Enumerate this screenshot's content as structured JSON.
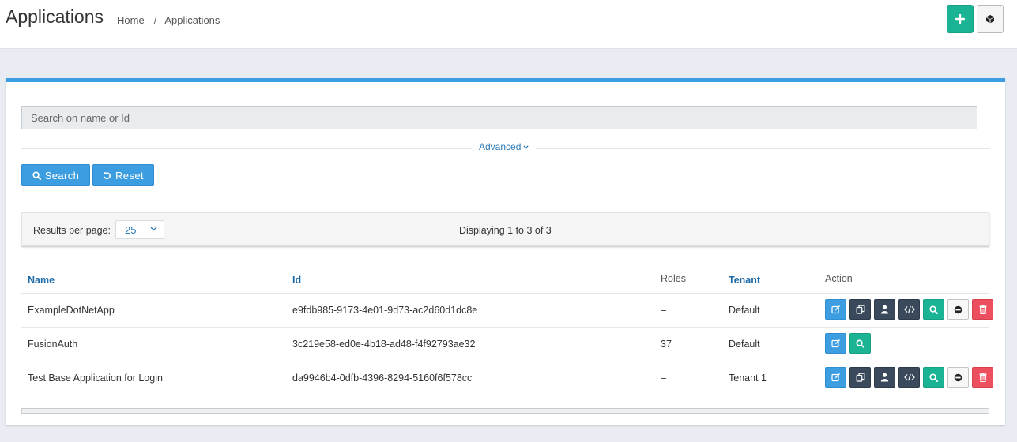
{
  "header": {
    "title": "Applications",
    "breadcrumb": [
      "Home",
      "Applications"
    ],
    "breadcrumb_sep": "/"
  },
  "colors": {
    "accent": "#3c9ee0",
    "success": "#1ab394",
    "danger": "#ed4f5f",
    "dark": "#3a4a5c"
  },
  "search": {
    "placeholder": "Search on name or Id",
    "advanced_label": "Advanced",
    "search_button": "Search",
    "reset_button": "Reset"
  },
  "pagination": {
    "results_per_page_label": "Results per page:",
    "results_per_page_value": "25",
    "displaying_text": "Displaying 1 to 3 of 3"
  },
  "table": {
    "columns": [
      "Name",
      "Id",
      "Roles",
      "Tenant",
      "Action"
    ],
    "rows": [
      {
        "name": "ExampleDotNetApp",
        "id": "e9fdb985-9173-4e01-9d73-ac2d60d1dc8e",
        "roles": "–",
        "tenant": "Default"
      },
      {
        "name": "FusionAuth",
        "id": "3c219e58-ed0e-4b18-ad48-f4f92793ae32",
        "roles": "37",
        "tenant": "Default"
      },
      {
        "name": "Test Base Application for Login",
        "id": "da9946b4-0dfb-4396-8294-5160f6f578cc",
        "roles": "–",
        "tenant": "Tenant 1"
      }
    ]
  },
  "icons": {
    "top_actions": [
      "plus-icon",
      "cube-icon"
    ],
    "row_actions": [
      "edit-icon",
      "copy-icon",
      "user-icon",
      "code-icon",
      "search-icon",
      "deactivate-icon",
      "trash-icon"
    ],
    "row_actions_limited": [
      "edit-icon",
      "search-icon"
    ]
  }
}
